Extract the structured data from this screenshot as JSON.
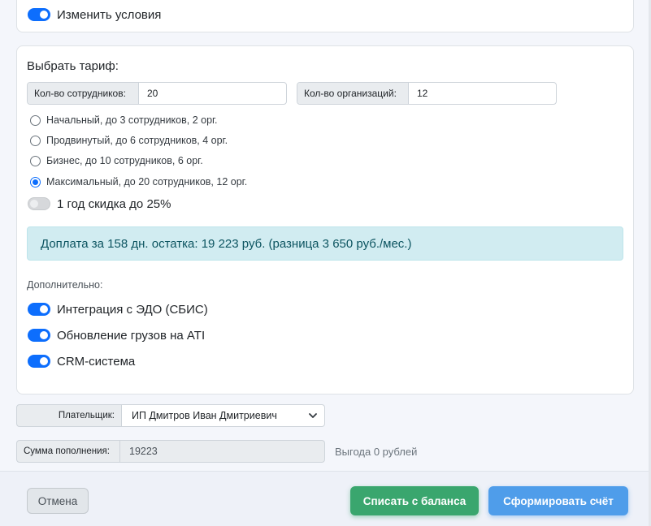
{
  "top_toggle": {
    "label": "Изменить условия",
    "on": true
  },
  "tariff": {
    "title": "Выбрать тариф:",
    "employees_label": "Кол-во сотрудников:",
    "employees_value": "20",
    "orgs_label": "Кол-во организаций:",
    "orgs_value": "12",
    "options": [
      {
        "label": "Начальный, до 3 сотрудников, 2 орг.",
        "checked": false
      },
      {
        "label": "Продвинутый, до 6 сотрудников, 4 орг.",
        "checked": false
      },
      {
        "label": "Бизнес, до 10 сотрудников, 6 орг.",
        "checked": false
      },
      {
        "label": "Максимальный, до 20 сотрудников, 12 орг.",
        "checked": true
      }
    ],
    "year_discount": {
      "label": "1 год скидка до 25%",
      "on": false
    },
    "alert": "Доплата за 158 дн. остатка: 19 223 руб. (разница 3 650 руб./мес.)",
    "extra_title": "Дополнительно:",
    "extras": [
      {
        "label": "Интеграция с ЭДО (СБИС)",
        "on": true
      },
      {
        "label": "Обновление грузов на ATI",
        "on": true
      },
      {
        "label": "CRM-система",
        "on": true
      }
    ]
  },
  "payer": {
    "label": "Плательщик:",
    "selected": "ИП Дмитров Иван Дмитриевич"
  },
  "sum": {
    "label": "Сумма пополнения:",
    "value": "19223"
  },
  "benefit": "Выгода 0 рублей",
  "footer": {
    "cancel": "Отмена",
    "pay_balance": "Списать с баланса",
    "make_invoice": "Сформировать счёт"
  },
  "colors": {
    "accent": "#0d6efd",
    "success": "#3aa66e",
    "primary_button": "#4f9dea",
    "alert_bg": "#d1ecf1",
    "alert_text": "#0c5460"
  }
}
